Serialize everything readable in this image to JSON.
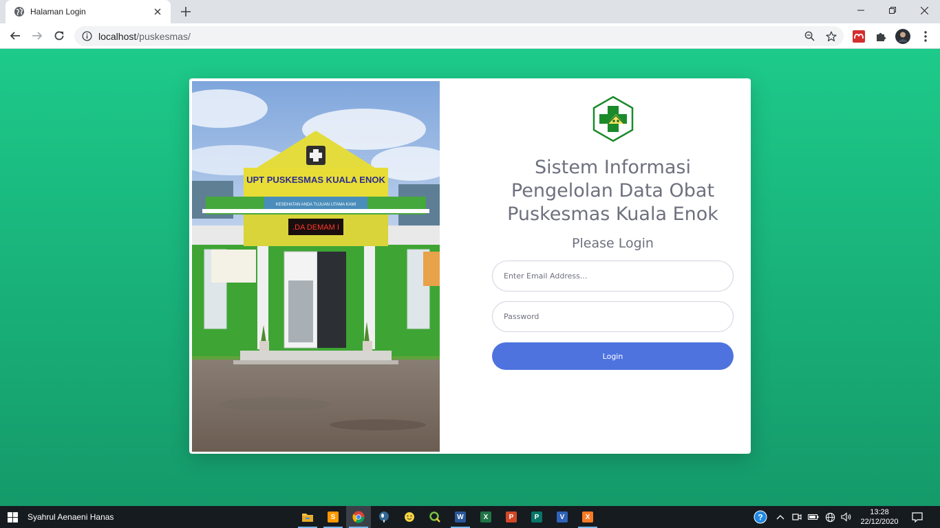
{
  "browser": {
    "tab_title": "Halaman Login",
    "url_host": "localhost",
    "url_path": "/puskesmas/"
  },
  "photo": {
    "sign_top": "UPT PUSKESMAS KUALA ENOK",
    "sign_banner": "KESEHATAN ANDA TUJUAN UTAMA KAMI",
    "led_text": ".DA DEMAM I"
  },
  "login": {
    "title_line1": "Sistem Informasi",
    "title_line2": "Pengelolan Data Obat",
    "title_line3": "Puskesmas Kuala Enok",
    "subtitle": "Please Login",
    "email_placeholder": "Enter Email Address...",
    "password_placeholder": "Password",
    "button_label": "Login"
  },
  "taskbar": {
    "user_name": "Syahrul Aenaeni Hanas",
    "time": "13:28",
    "date": "22/12/2020",
    "apps": [
      "file-explorer",
      "sublime-text",
      "chrome",
      "pgadmin",
      "emoji-app",
      "qgis",
      "word",
      "excel",
      "powerpoint",
      "publisher",
      "visual-studio",
      "xampp"
    ]
  },
  "colors": {
    "page_gradient_top": "#1dca8a",
    "page_gradient_bottom": "#159a6a",
    "button": "#4e73df",
    "text_gray": "#6e707e",
    "logo_green": "#1a8a2a"
  }
}
